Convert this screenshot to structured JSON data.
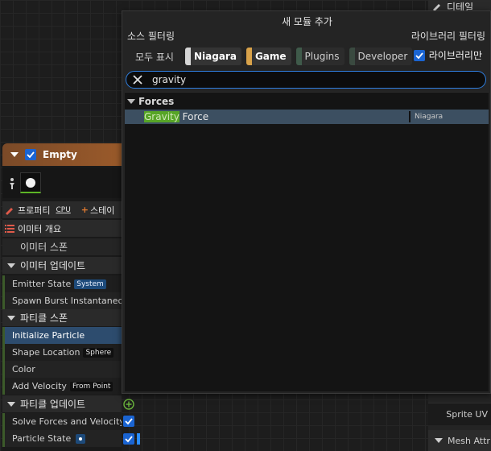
{
  "detail_tab": {
    "label": "디테일",
    "icon": "pencil-icon"
  },
  "popup": {
    "title": "새 모듈 추가",
    "source_filter_label": "소스 필터링",
    "library_filter_label": "라이브러리 필터링",
    "filters": [
      {
        "label": "모두 표시",
        "color": "",
        "active": false
      },
      {
        "label": "Niagara",
        "color": "#d6d6d6",
        "active": true
      },
      {
        "label": "Game",
        "color": "#d8a24a",
        "active": true
      },
      {
        "label": "Plugins",
        "color": "#3f5a4a",
        "active": false
      },
      {
        "label": "Developer",
        "color": "#3a4a40",
        "active": false
      }
    ],
    "library_only_label": "라이브러리만",
    "library_only_checked": true,
    "search": {
      "value": "gravity",
      "clear_icon": "close-icon"
    },
    "results": {
      "category": "Forces",
      "items": [
        {
          "match": "Gravity",
          "rest": " Force",
          "source": "Niagara"
        }
      ]
    }
  },
  "stack": {
    "emitter_name": "Empty",
    "rows": {
      "properties": "프로퍼티",
      "cpu_badge": "CPU",
      "stage": "스테이",
      "emitter_summary": "이미터 개요",
      "emitter_spawn": "이미터 스폰",
      "emitter_update": "이미터 업데이트",
      "emitter_state": "Emitter State",
      "emitter_state_badge": "System",
      "spawn_burst": "Spawn Burst Instantaneous",
      "particle_spawn": "파티클 스폰",
      "initialize_particle": "Initialize Particle",
      "shape_location": "Shape Location",
      "shape_badge": "Sphere",
      "color": "Color",
      "add_velocity": "Add Velocity",
      "velocity_badge": "From Point",
      "particle_update": "파티클 업데이트",
      "solve_forces": "Solve Forces and Velocity",
      "particle_state": "Particle State"
    }
  },
  "right_panel": {
    "sprite_uv": "Sprite UV",
    "mesh_attr": "Mesh Attr"
  }
}
